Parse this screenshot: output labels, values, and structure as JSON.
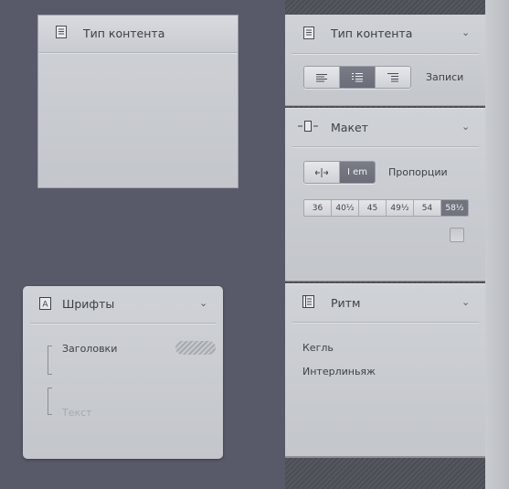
{
  "panel_content_left": {
    "title": "Тип контента"
  },
  "panel_content_right": {
    "title": "Тип контента",
    "mode_label": "Записи"
  },
  "panel_layout": {
    "title": "Макет",
    "proportion_label": "Пропорции",
    "em_button_label": "I em",
    "sizes": [
      "36",
      "40½",
      "45",
      "49½",
      "54",
      "58½"
    ],
    "selected_size": "58½"
  },
  "panel_fonts": {
    "title": "Шрифты",
    "items": [
      {
        "label": "Заголовки"
      },
      {
        "label": "Текст"
      }
    ]
  },
  "panel_rhythm": {
    "title": "Ритм",
    "items": [
      {
        "label": "Кегль"
      },
      {
        "label": "Интерлиньяж"
      }
    ]
  },
  "colors": {
    "background": "#585a69",
    "panel": "#c8cbd0",
    "active": "#6e717b"
  }
}
